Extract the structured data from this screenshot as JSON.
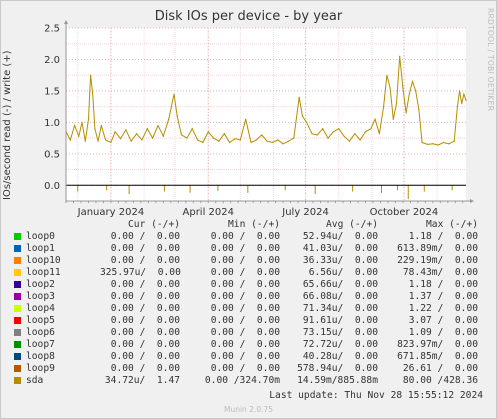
{
  "title": "Disk IOs per device - by year",
  "side_label": "RRDTOOL / TOBI OETIKER",
  "footer": {
    "last_update": "Last update: Thu Nov 28 15:55:12 2024",
    "version": "Munin 2.0.75"
  },
  "legend": {
    "headers": {
      "cur": "Cur (-/+)",
      "min": "Min (-/+)",
      "avg": "Avg (-/+)",
      "max": "Max (-/+)"
    },
    "rows": [
      {
        "name": "loop0",
        "color": "#00cc00",
        "cur": "0.00 /  0.00",
        "min": "0.00 /  0.00",
        "avg": "52.94u/  0.00",
        "max": "1.18 /  0.00"
      },
      {
        "name": "loop1",
        "color": "#0066b3",
        "cur": "0.00 /  0.00",
        "min": "0.00 /  0.00",
        "avg": "41.03u/  0.00",
        "max": "613.89m/  0.00"
      },
      {
        "name": "loop10",
        "color": "#ff8000",
        "cur": "0.00 /  0.00",
        "min": "0.00 /  0.00",
        "avg": "36.33u/  0.00",
        "max": "229.19m/  0.00"
      },
      {
        "name": "loop11",
        "color": "#ffcc00",
        "cur": "325.97u/  0.00",
        "min": "0.00 /  0.00",
        "avg": "6.56u/  0.00",
        "max": "78.43m/  0.00"
      },
      {
        "name": "loop2",
        "color": "#330099",
        "cur": "0.00 /  0.00",
        "min": "0.00 /  0.00",
        "avg": "65.66u/  0.00",
        "max": "1.18 /  0.00"
      },
      {
        "name": "loop3",
        "color": "#990099",
        "cur": "0.00 /  0.00",
        "min": "0.00 /  0.00",
        "avg": "66.08u/  0.00",
        "max": "1.37 /  0.00"
      },
      {
        "name": "loop4",
        "color": "#ccff00",
        "cur": "0.00 /  0.00",
        "min": "0.00 /  0.00",
        "avg": "71.34u/  0.00",
        "max": "1.22 /  0.00"
      },
      {
        "name": "loop5",
        "color": "#ff0000",
        "cur": "0.00 /  0.00",
        "min": "0.00 /  0.00",
        "avg": "91.61u/  0.00",
        "max": "3.07 /  0.00"
      },
      {
        "name": "loop6",
        "color": "#808080",
        "cur": "0.00 /  0.00",
        "min": "0.00 /  0.00",
        "avg": "73.15u/  0.00",
        "max": "1.09 /  0.00"
      },
      {
        "name": "loop7",
        "color": "#008f00",
        "cur": "0.00 /  0.00",
        "min": "0.00 /  0.00",
        "avg": "72.72u/  0.00",
        "max": "823.97m/  0.00"
      },
      {
        "name": "loop8",
        "color": "#00487d",
        "cur": "0.00 /  0.00",
        "min": "0.00 /  0.00",
        "avg": "40.28u/  0.00",
        "max": "671.85m/  0.00"
      },
      {
        "name": "loop9",
        "color": "#b35a00",
        "cur": "0.00 /  0.00",
        "min": "0.00 /  0.00",
        "avg": "578.94u/  0.00",
        "max": "26.61 /  0.00"
      },
      {
        "name": "sda",
        "color": "#b38f00",
        "cur": "34.72u/  1.47",
        "min": "0.00 /324.70m",
        "avg": "14.59m/885.88m",
        "max": "80.00 /428.36"
      }
    ]
  },
  "chart_data": {
    "type": "line",
    "title": "Disk IOs per device - by year",
    "ylabel": "IOs/second read (-) / write (+)",
    "ylim": [
      -0.25,
      2.5
    ],
    "y_ticks": [
      {
        "value": 2.5,
        "label": "2.5"
      },
      {
        "value": 2.0,
        "label": "2.0"
      },
      {
        "value": 1.5,
        "label": "1.5"
      },
      {
        "value": 1.0,
        "label": "1.0"
      },
      {
        "value": 0.5,
        "label": "0.5"
      },
      {
        "value": 0.0,
        "label": "0.0"
      }
    ],
    "x_range": [
      "2023-11-20",
      "2024-11-28"
    ],
    "x_ticks": [
      {
        "date": "2024-01-01",
        "label": "January 2024"
      },
      {
        "date": "2024-04-01",
        "label": "April 2024"
      },
      {
        "date": "2024-07-01",
        "label": "July 2024"
      },
      {
        "date": "2024-10-01",
        "label": "October 2024"
      }
    ],
    "grid": true,
    "series": [
      {
        "name": "sda",
        "color": "#b38f00",
        "write_points": [
          [
            "2023-11-20",
            0.85
          ],
          [
            "2023-11-24",
            0.72
          ],
          [
            "2023-11-28",
            0.95
          ],
          [
            "2023-12-02",
            0.78
          ],
          [
            "2023-12-05",
            1.0
          ],
          [
            "2023-12-08",
            0.7
          ],
          [
            "2023-12-11",
            1.05
          ],
          [
            "2023-12-13",
            1.75
          ],
          [
            "2023-12-15",
            1.45
          ],
          [
            "2023-12-17",
            0.9
          ],
          [
            "2023-12-20",
            0.7
          ],
          [
            "2023-12-23",
            0.95
          ],
          [
            "2023-12-27",
            0.72
          ],
          [
            "2024-01-01",
            0.68
          ],
          [
            "2024-01-05",
            0.85
          ],
          [
            "2024-01-10",
            0.74
          ],
          [
            "2024-01-15",
            0.88
          ],
          [
            "2024-01-20",
            0.7
          ],
          [
            "2024-01-25",
            0.82
          ],
          [
            "2024-01-30",
            0.72
          ],
          [
            "2024-02-04",
            0.9
          ],
          [
            "2024-02-09",
            0.75
          ],
          [
            "2024-02-14",
            0.95
          ],
          [
            "2024-02-19",
            0.78
          ],
          [
            "2024-02-24",
            1.05
          ],
          [
            "2024-02-29",
            1.45
          ],
          [
            "2024-03-03",
            1.1
          ],
          [
            "2024-03-07",
            0.8
          ],
          [
            "2024-03-12",
            0.75
          ],
          [
            "2024-03-17",
            0.9
          ],
          [
            "2024-03-22",
            0.72
          ],
          [
            "2024-03-27",
            0.68
          ],
          [
            "2024-04-01",
            0.85
          ],
          [
            "2024-04-06",
            0.75
          ],
          [
            "2024-04-11",
            0.7
          ],
          [
            "2024-04-16",
            0.82
          ],
          [
            "2024-04-21",
            0.68
          ],
          [
            "2024-04-26",
            0.74
          ],
          [
            "2024-05-01",
            0.72
          ],
          [
            "2024-05-06",
            1.05
          ],
          [
            "2024-05-11",
            0.68
          ],
          [
            "2024-05-16",
            0.72
          ],
          [
            "2024-05-21",
            0.8
          ],
          [
            "2024-05-26",
            0.7
          ],
          [
            "2024-05-31",
            0.68
          ],
          [
            "2024-06-05",
            0.72
          ],
          [
            "2024-06-10",
            0.66
          ],
          [
            "2024-06-15",
            0.7
          ],
          [
            "2024-06-20",
            0.75
          ],
          [
            "2024-06-25",
            1.4
          ],
          [
            "2024-06-28",
            1.1
          ],
          [
            "2024-07-02",
            1.0
          ],
          [
            "2024-07-07",
            0.82
          ],
          [
            "2024-07-12",
            0.8
          ],
          [
            "2024-07-17",
            0.9
          ],
          [
            "2024-07-22",
            0.75
          ],
          [
            "2024-07-27",
            0.85
          ],
          [
            "2024-08-01",
            0.9
          ],
          [
            "2024-08-06",
            0.78
          ],
          [
            "2024-08-11",
            0.7
          ],
          [
            "2024-08-16",
            0.82
          ],
          [
            "2024-08-21",
            0.72
          ],
          [
            "2024-08-26",
            0.85
          ],
          [
            "2024-08-31",
            0.9
          ],
          [
            "2024-09-04",
            1.05
          ],
          [
            "2024-09-08",
            0.82
          ],
          [
            "2024-09-12",
            1.25
          ],
          [
            "2024-09-15",
            1.75
          ],
          [
            "2024-09-18",
            1.55
          ],
          [
            "2024-09-21",
            1.05
          ],
          [
            "2024-09-24",
            1.3
          ],
          [
            "2024-09-27",
            2.05
          ],
          [
            "2024-09-30",
            1.55
          ],
          [
            "2024-10-03",
            1.15
          ],
          [
            "2024-10-06",
            1.45
          ],
          [
            "2024-10-09",
            1.65
          ],
          [
            "2024-10-12",
            1.5
          ],
          [
            "2024-10-15",
            1.2
          ],
          [
            "2024-10-18",
            0.68
          ],
          [
            "2024-10-23",
            0.65
          ],
          [
            "2024-10-28",
            0.66
          ],
          [
            "2024-11-02",
            0.64
          ],
          [
            "2024-11-07",
            0.68
          ],
          [
            "2024-11-12",
            0.66
          ],
          [
            "2024-11-17",
            0.7
          ],
          [
            "2024-11-20",
            1.25
          ],
          [
            "2024-11-22",
            1.5
          ],
          [
            "2024-11-24",
            1.3
          ],
          [
            "2024-11-26",
            1.45
          ],
          [
            "2024-11-28",
            1.35
          ]
        ],
        "read_spikes": [
          [
            "2023-12-01",
            -0.1
          ],
          [
            "2023-12-28",
            -0.08
          ],
          [
            "2024-01-18",
            -0.14
          ],
          [
            "2024-02-20",
            -0.1
          ],
          [
            "2024-03-15",
            -0.12
          ],
          [
            "2024-04-10",
            -0.09
          ],
          [
            "2024-05-08",
            -0.12
          ],
          [
            "2024-06-12",
            -0.08
          ],
          [
            "2024-07-10",
            -0.14
          ],
          [
            "2024-08-14",
            -0.1
          ],
          [
            "2024-09-10",
            -0.12
          ],
          [
            "2024-09-25",
            -0.08
          ],
          [
            "2024-10-05",
            -0.22
          ],
          [
            "2024-10-20",
            -0.1
          ],
          [
            "2024-11-15",
            -0.08
          ]
        ]
      }
    ]
  }
}
